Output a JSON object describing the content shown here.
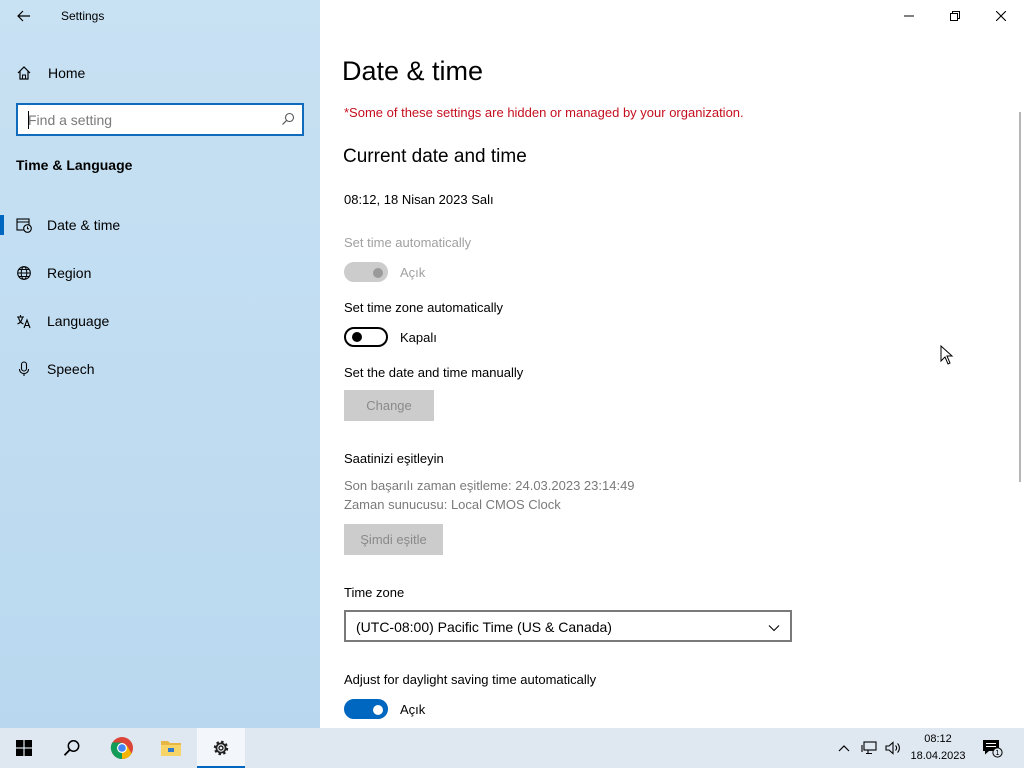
{
  "window": {
    "app_title": "Settings"
  },
  "sidebar": {
    "home_label": "Home",
    "search_placeholder": "Find a setting",
    "section_title": "Time & Language",
    "items": [
      {
        "label": "Date & time",
        "icon": "date-time-icon",
        "selected": true
      },
      {
        "label": "Region",
        "icon": "globe-icon",
        "selected": false
      },
      {
        "label": "Language",
        "icon": "language-icon",
        "selected": false
      },
      {
        "label": "Speech",
        "icon": "microphone-icon",
        "selected": false
      }
    ]
  },
  "main": {
    "page_title": "Date & time",
    "org_warning": "*Some of these settings are hidden or managed by your organization.",
    "current_heading": "Current date and time",
    "current_value": "08:12, 18 Nisan 2023 Salı",
    "set_time_auto": {
      "label": "Set time automatically",
      "state_label": "Açık",
      "on": true,
      "disabled": true
    },
    "set_tz_auto": {
      "label": "Set time zone automatically",
      "state_label": "Kapalı",
      "on": false,
      "disabled": false
    },
    "manual": {
      "label": "Set the date and time manually",
      "button": "Change"
    },
    "sync": {
      "heading": "Saatinizi eşitleyin",
      "last_sync": "Son başarılı zaman eşitleme:  24.03.2023 23:14:49",
      "server": "Zaman sunucusu:  Local CMOS Clock",
      "button": "Şimdi eşitle"
    },
    "timezone": {
      "label": "Time zone",
      "value": "(UTC-08:00) Pacific Time (US & Canada)"
    },
    "dst": {
      "label": "Adjust for daylight saving time automatically",
      "state_label": "Açık",
      "on": true
    }
  },
  "taskbar": {
    "apps": [
      "windows-start-icon",
      "search-icon",
      "chrome-icon",
      "file-explorer-icon",
      "settings-gear-icon"
    ],
    "time": "08:12",
    "date": "18.04.2023",
    "notification_count": "1"
  },
  "colors": {
    "accent": "#0067c0",
    "sidebar_bg": "#c8e1f3",
    "warning": "#c50f1f",
    "disabled": "#cccccc"
  }
}
